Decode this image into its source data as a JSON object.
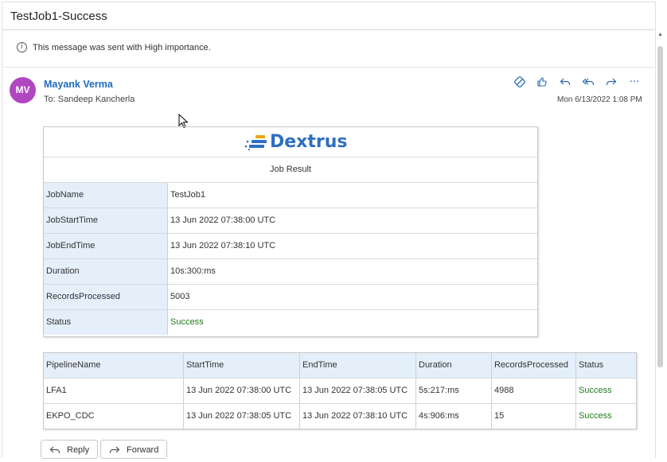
{
  "message": {
    "subject": "TestJob1-Success",
    "importance_note": "This message was sent with High importance.",
    "sender_initials": "MV",
    "sender_name": "Mayank Verma",
    "to": "To:  Sandeep Kancherla",
    "date": "Mon 6/13/2022 1:08 PM"
  },
  "actions": [
    "immersive-reader-icon",
    "like-icon",
    "reply-icon",
    "reply-all-icon",
    "forward-icon",
    "more-icon"
  ],
  "body": {
    "logo_text": "Dextrus",
    "job_result_title": "Job Result",
    "job_fields": [
      {
        "key": "JobName",
        "value": "TestJob1"
      },
      {
        "key": "JobStartTime",
        "value": "13 Jun 2022 07:38:00 UTC"
      },
      {
        "key": "JobEndTime",
        "value": "13 Jun 2022 07:38:10 UTC"
      },
      {
        "key": "Duration",
        "value": "10s:300:ms"
      },
      {
        "key": "RecordsProcessed",
        "value": "5003"
      },
      {
        "key": "Status",
        "value": "Success"
      }
    ],
    "pipeline_columns": [
      "PipelineName",
      "StartTime",
      "EndTime",
      "Duration",
      "RecordsProcessed",
      "Status"
    ],
    "pipeline_rows": [
      [
        "LFA1",
        "13 Jun 2022 07:38:00 UTC",
        "13 Jun 2022 07:38:05 UTC",
        "5s:217:ms",
        "4988",
        "Success"
      ],
      [
        "EKPO_CDC",
        "13 Jun 2022 07:38:05 UTC",
        "13 Jun 2022 07:38:10 UTC",
        "4s:906:ms",
        "15",
        "Success"
      ]
    ]
  },
  "footer": {
    "reply_label": "Reply",
    "forward_label": "Forward"
  },
  "colors": {
    "accent": "#2867b2",
    "avatar": "#b146c2",
    "success": "#1f7a1f",
    "header_cell": "#e4effa"
  }
}
